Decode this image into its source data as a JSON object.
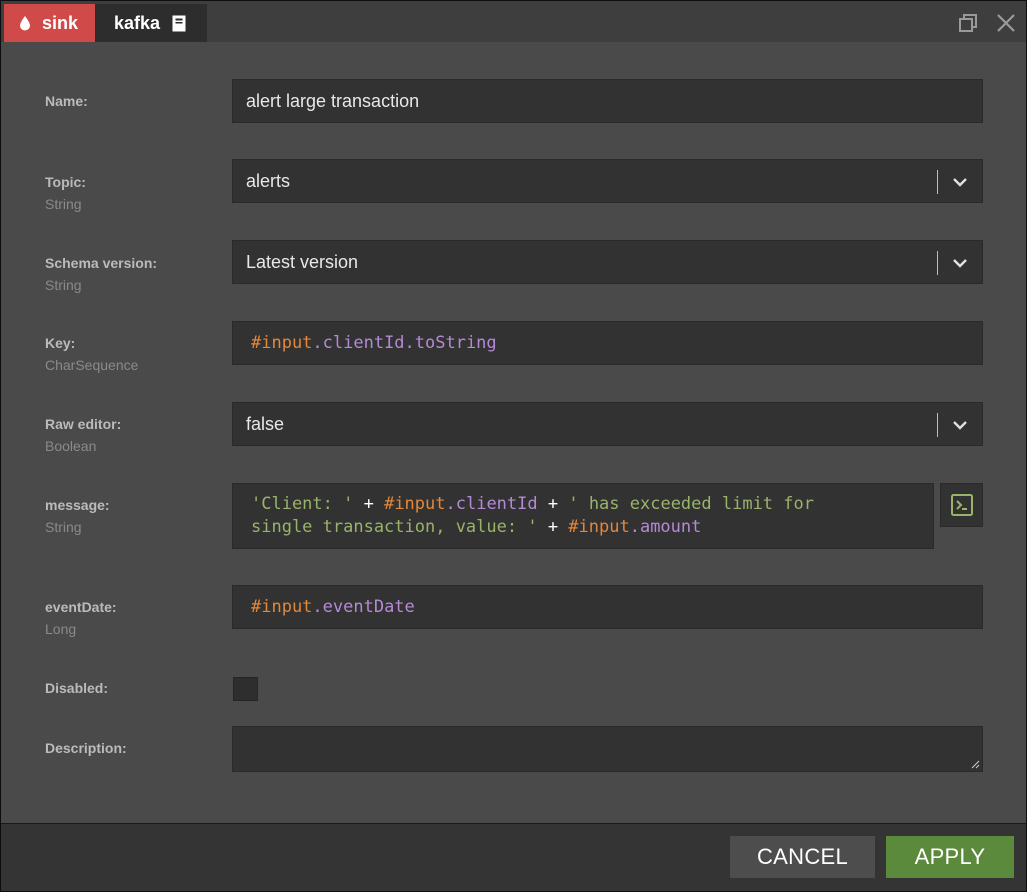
{
  "header": {
    "node_type_label": "sink",
    "component_label": "kafka",
    "node_type_color": "#d04a4a"
  },
  "icons": {
    "node_type": "drop-icon",
    "component": "document-icon",
    "maximize": "maximize-icon",
    "close": "close-icon",
    "expression_editor": "terminal-icon",
    "dropdown": "chevron-down-icon",
    "resize": "resize-grip-icon"
  },
  "form": {
    "name": {
      "label": "Name:",
      "value": "alert large transaction"
    },
    "topic": {
      "label": "Topic:",
      "type": "String",
      "value": "alerts"
    },
    "schema_version": {
      "label": "Schema version:",
      "type": "String",
      "value": "Latest version"
    },
    "key": {
      "label": "Key:",
      "type": "CharSequence",
      "tokens": [
        "#input",
        ".clientId.toString"
      ]
    },
    "raw_editor": {
      "label": "Raw editor:",
      "type": "Boolean",
      "value": "false"
    },
    "message": {
      "label": "message:",
      "type": "String",
      "line1": [
        "'Client: '",
        " + ",
        "#input",
        ".clientId",
        " + ",
        "' has exceeded limit for"
      ],
      "line2": [
        "single transaction, value: '",
        " + ",
        "#input",
        ".amount"
      ]
    },
    "event_date": {
      "label": "eventDate:",
      "type": "Long",
      "tokens": [
        "#input",
        ".eventDate"
      ]
    },
    "disabled": {
      "label": "Disabled:",
      "checked": false
    },
    "description": {
      "label": "Description:",
      "value": ""
    }
  },
  "footer": {
    "cancel_label": "CANCEL",
    "apply_label": "APPLY",
    "apply_color": "#5c8a3c"
  }
}
